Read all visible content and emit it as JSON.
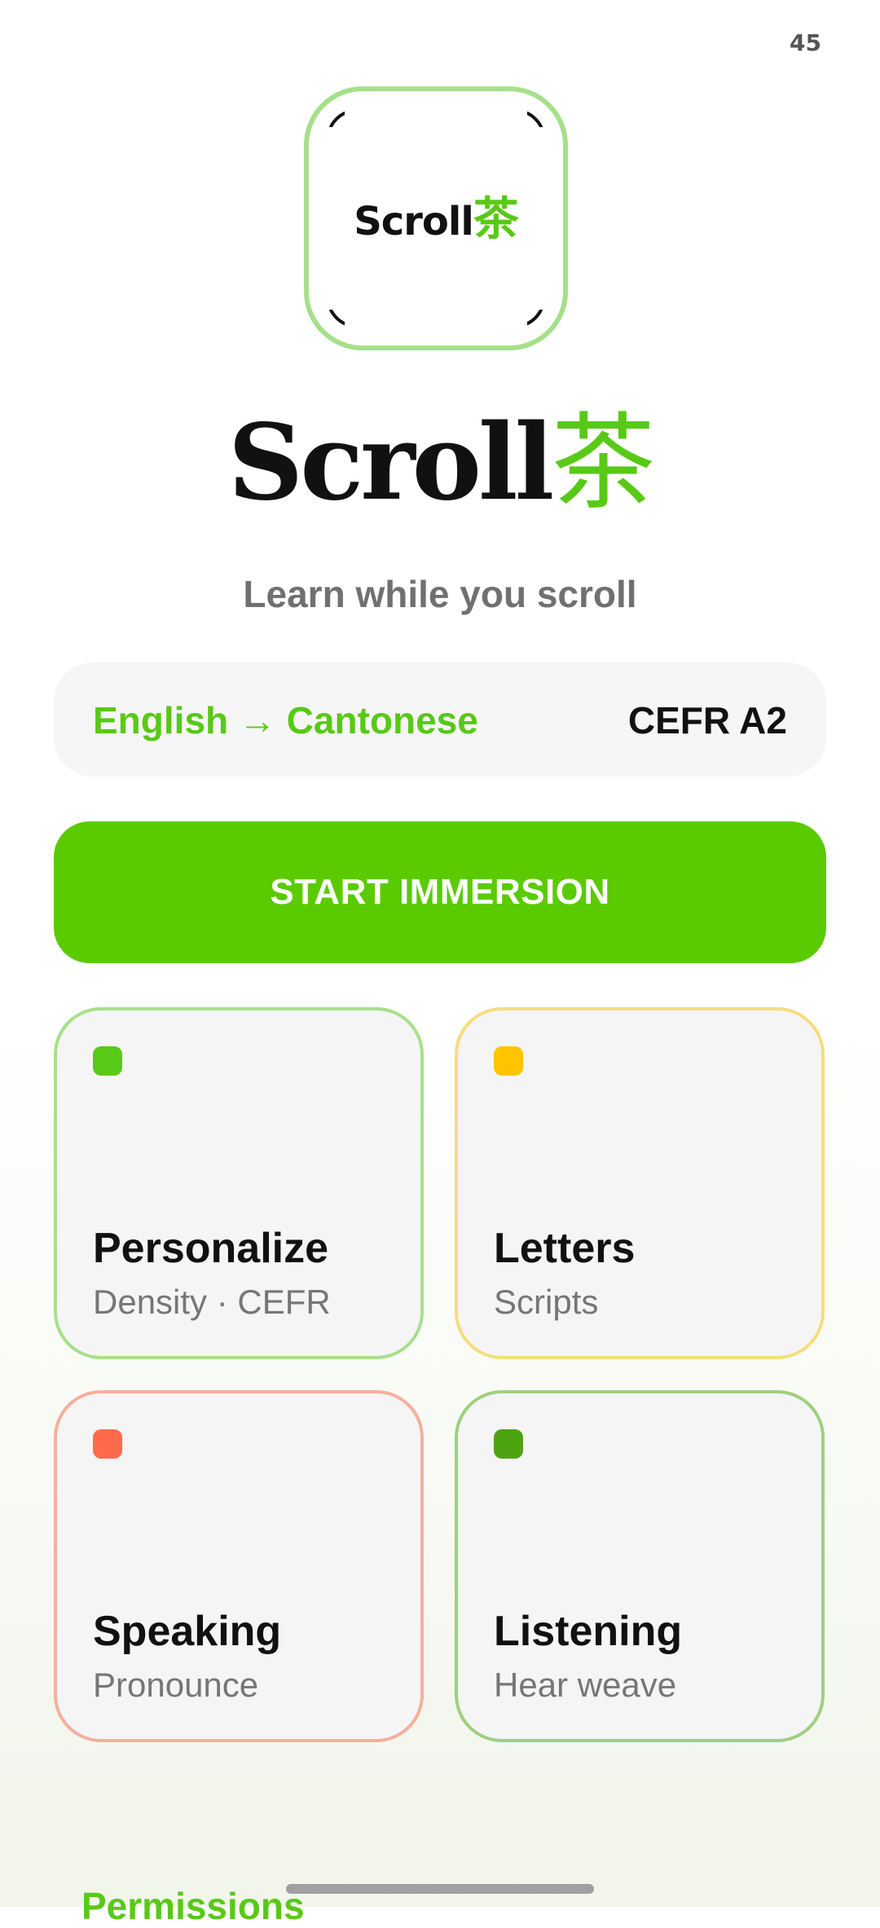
{
  "status": {
    "time": "45"
  },
  "logo": {
    "word": "Scroll",
    "char": "茶"
  },
  "title": {
    "word": "Scroll",
    "char": "茶"
  },
  "tagline": "Learn while you scroll",
  "language": {
    "pair": "English → Cantonese",
    "level": "CEFR A2"
  },
  "start_button": "START IMMERSION",
  "tiles": [
    {
      "title": "Personalize",
      "subtitle": "Density · CEFR",
      "border": "#a6e08a",
      "dot": "#58c917"
    },
    {
      "title": "Letters",
      "subtitle": "Scripts",
      "border": "#f5dd7e",
      "dot": "#ffc400"
    },
    {
      "title": "Speaking",
      "subtitle": "Pronounce",
      "border": "#f4b09c",
      "dot": "#ff6a4d"
    },
    {
      "title": "Listening",
      "subtitle": "Hear weave",
      "border": "#9fd07f",
      "dot": "#4ea311"
    }
  ],
  "permissions_label": "Permissions",
  "colors": {
    "accent": "#58c917",
    "button": "#5acb00"
  }
}
